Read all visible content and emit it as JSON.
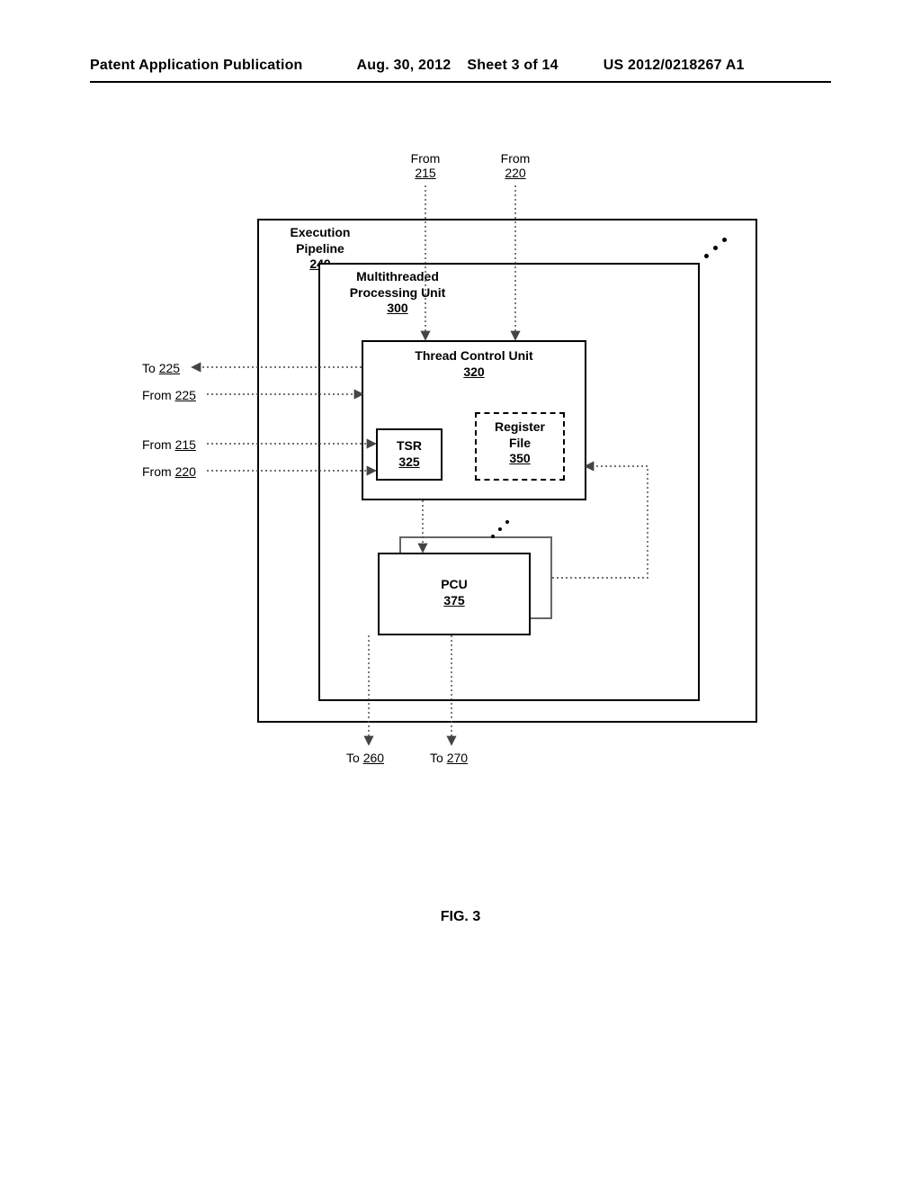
{
  "header": {
    "pub_label": "Patent Application Publication",
    "pub_date": "Aug. 30, 2012",
    "sheet": "Sheet 3 of 14",
    "pub_num": "US 2012/0218267 A1"
  },
  "labels": {
    "from_215_top": {
      "text_a": "From",
      "text_b": "215"
    },
    "from_220_top": {
      "text_a": "From",
      "text_b": "220"
    },
    "to_225": {
      "text_a": "To",
      "text_b": "225"
    },
    "from_225": {
      "text_a": "From",
      "text_b": "225"
    },
    "from_215_l": {
      "text_a": "From",
      "text_b": "215"
    },
    "from_220_l": {
      "text_a": "From",
      "text_b": "220"
    },
    "to_260": {
      "text_a": "To",
      "text_b": "260"
    },
    "to_270": {
      "text_a": "To",
      "text_b": "270"
    }
  },
  "boxes": {
    "execution_pipeline": {
      "title_a": "Execution",
      "title_b": "Pipeline",
      "num": "240"
    },
    "mpu": {
      "title_a": "Multithreaded",
      "title_b": "Processing Unit",
      "num": "300"
    },
    "tcu": {
      "title_a": "Thread Control Unit",
      "num": "320"
    },
    "tsr": {
      "title_a": "TSR",
      "num": "325"
    },
    "regfile": {
      "title_a": "Register",
      "title_b": "File",
      "num": "350"
    },
    "pcu": {
      "title_a": "PCU",
      "num": "375"
    }
  },
  "figure_label": "FIG. 3"
}
